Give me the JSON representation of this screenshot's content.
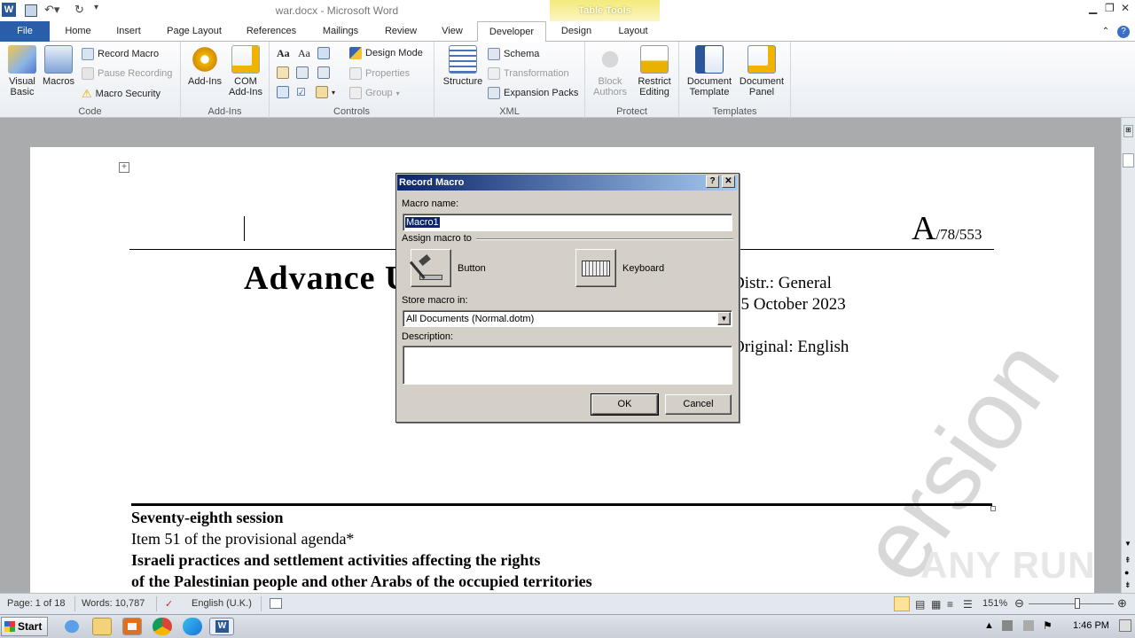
{
  "window": {
    "title": "war.docx - Microsoft Word",
    "table_tools": "Table Tools"
  },
  "tabs": [
    "File",
    "Home",
    "Insert",
    "Page Layout",
    "References",
    "Mailings",
    "Review",
    "View",
    "Developer",
    "Design",
    "Layout"
  ],
  "ribbon": {
    "code": {
      "label": "Code",
      "visual_basic": "Visual Basic",
      "macros": "Macros",
      "record_macro": "Record Macro",
      "pause_recording": "Pause Recording",
      "macro_security": "Macro Security"
    },
    "addins": {
      "label": "Add-Ins",
      "addins": "Add-Ins",
      "com_addins": "COM Add-Ins"
    },
    "controls": {
      "label": "Controls",
      "design_mode": "Design Mode",
      "properties": "Properties",
      "group": "Group"
    },
    "xml": {
      "label": "XML",
      "structure": "Structure",
      "schema": "Schema",
      "transformation": "Transformation",
      "expansion_packs": "Expansion Packs"
    },
    "protect": {
      "label": "Protect",
      "block_authors": "Block Authors",
      "restrict_editing": "Restrict Editing"
    },
    "templates": {
      "label": "Templates",
      "document_template": "Document Template",
      "document_panel": "Document Panel"
    }
  },
  "document": {
    "symbol_a": "A",
    "symbol_rest": "/78/553",
    "heading": "Advance U",
    "distr": "Distr.: General",
    "date": "25 October 2023",
    "original": "Original: English",
    "session": "Seventy-eighth session",
    "item": "Item 51 of the provisional agenda*",
    "line1": "Israeli practices and settlement activities affecting the rights",
    "line2": "of the Palestinian people and other Arabs of the occupied territories",
    "watermark": "ersion"
  },
  "dialog": {
    "title": "Record Macro",
    "macro_name_label": "Macro name:",
    "macro_name_value": "Macro1",
    "assign_label": "Assign macro to",
    "button_label": "Button",
    "keyboard_label": "Keyboard",
    "store_label": "Store macro in:",
    "store_value": "All Documents (Normal.dotm)",
    "description_label": "Description:",
    "ok": "OK",
    "cancel": "Cancel"
  },
  "status": {
    "page": "Page: 1 of 18",
    "words": "Words: 10,787",
    "language": "English (U.K.)",
    "zoom": "151%"
  },
  "taskbar": {
    "start": "Start",
    "time": "1:46 PM"
  },
  "anyrun": "ANY RUN"
}
